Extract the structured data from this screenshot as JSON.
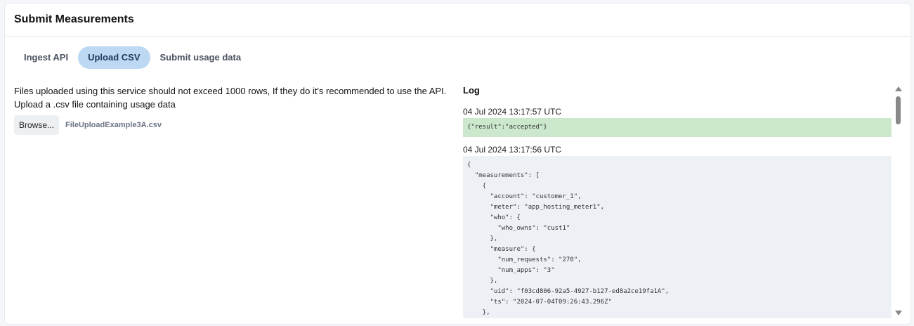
{
  "header": {
    "title": "Submit Measurements"
  },
  "tabs": [
    {
      "label": "Ingest API"
    },
    {
      "label": "Upload CSV",
      "active": true
    },
    {
      "label": "Submit usage data"
    }
  ],
  "upload": {
    "info": "Files uploaded using this service should not exceed 1000 rows, If they do it's recommended to use the API.",
    "prompt": "Upload a .csv file containing usage data",
    "browse_label": "Browse...",
    "file_name": "FileUploadExample3A.csv"
  },
  "log": {
    "title": "Log",
    "entries": [
      {
        "timestamp": "04 Jul 2024 13:17:57 UTC",
        "body": "{\"result\":\"accepted\"}"
      },
      {
        "timestamp": "04 Jul 2024 13:17:56 UTC",
        "body": "{\n  \"measurements\": [\n    {\n      \"account\": \"customer_1\",\n      \"meter\": \"app_hosting_meter1\",\n      \"who\": {\n        \"who_owns\": \"cust1\"\n      },\n      \"measure\": {\n        \"num_requests\": \"270\",\n        \"num_apps\": \"3\"\n      },\n      \"uid\": \"f03cd806-92a5-4927-b127-ed8a2ce19fa1A\",\n      \"ts\": \"2024-07-04T09:26:43.296Z\"\n    },"
      }
    ]
  }
}
